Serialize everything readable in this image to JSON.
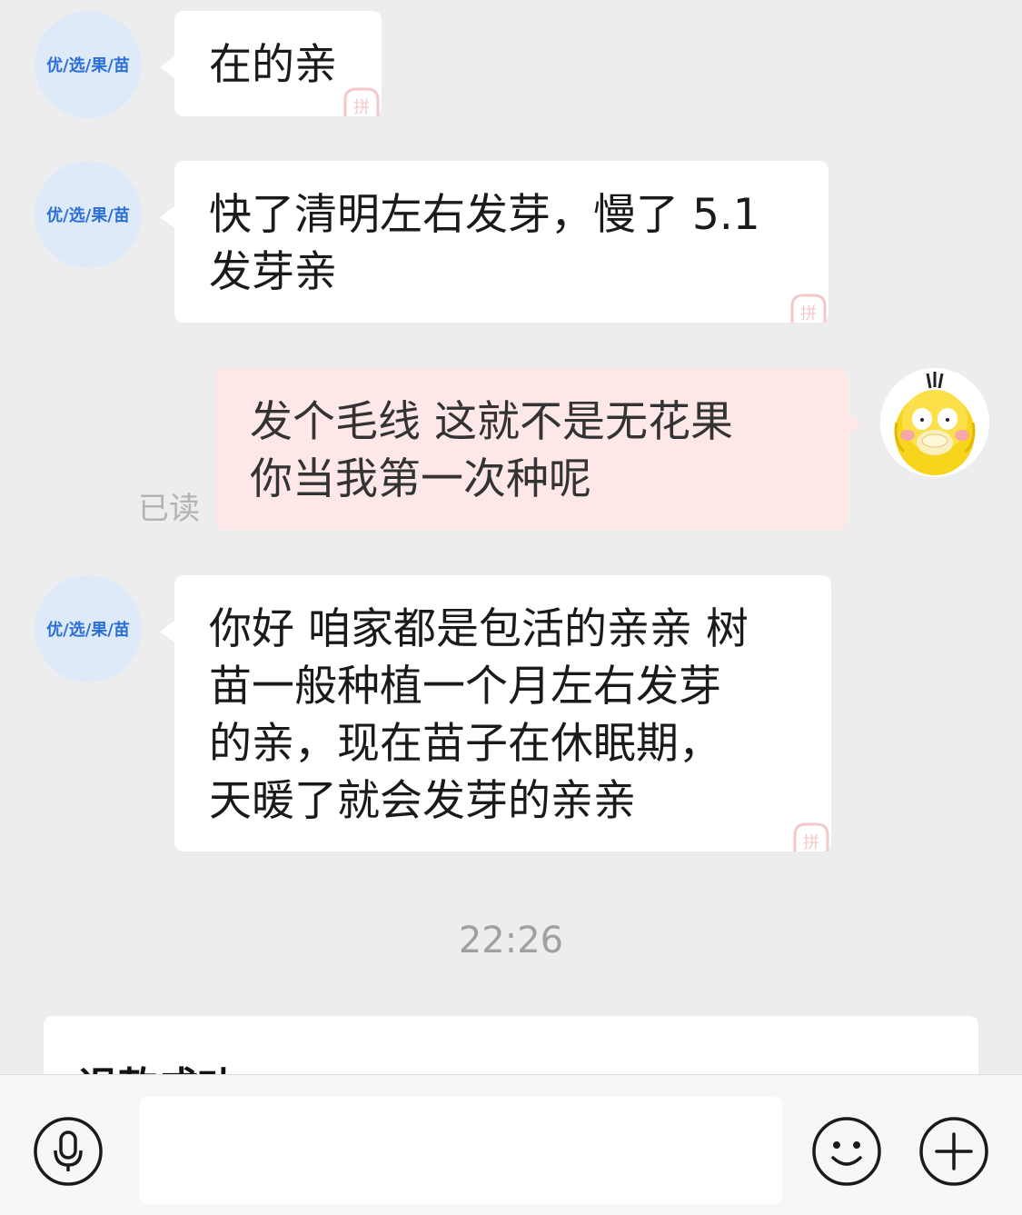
{
  "messages": [
    {
      "direction": "in",
      "sender_label": "优/选/果/苗",
      "text": "在的亲"
    },
    {
      "direction": "in",
      "sender_label": "优/选/果/苗",
      "lines": [
        "快了清明左右发芽，慢了 5.1",
        "发芽亲"
      ]
    },
    {
      "direction": "out",
      "read_status": "已读",
      "lines": [
        "发个毛线  这就不是无花果",
        "你当我第一次种呢"
      ]
    },
    {
      "direction": "in",
      "sender_label": "优/选/果/苗",
      "lines": [
        "你好 咱家都是包活的亲亲 树",
        "苗一般种植一个月左右发芽",
        "的亲，现在苗子在休眠期，",
        "天暖了就会发芽的亲亲"
      ]
    }
  ],
  "timestamp": "22:26",
  "card": {
    "title": "退款成功"
  },
  "input_bar": {
    "voice_icon": "microphone-icon",
    "emoji_icon": "smiley-icon",
    "more_icon": "plus-icon",
    "placeholder": ""
  },
  "colors": {
    "background": "#ededed",
    "incoming_bubble": "#ffffff",
    "outgoing_bubble": "#fde8e7",
    "shop_label": "#2c6fd8",
    "watermark": "#f3c9c9"
  }
}
